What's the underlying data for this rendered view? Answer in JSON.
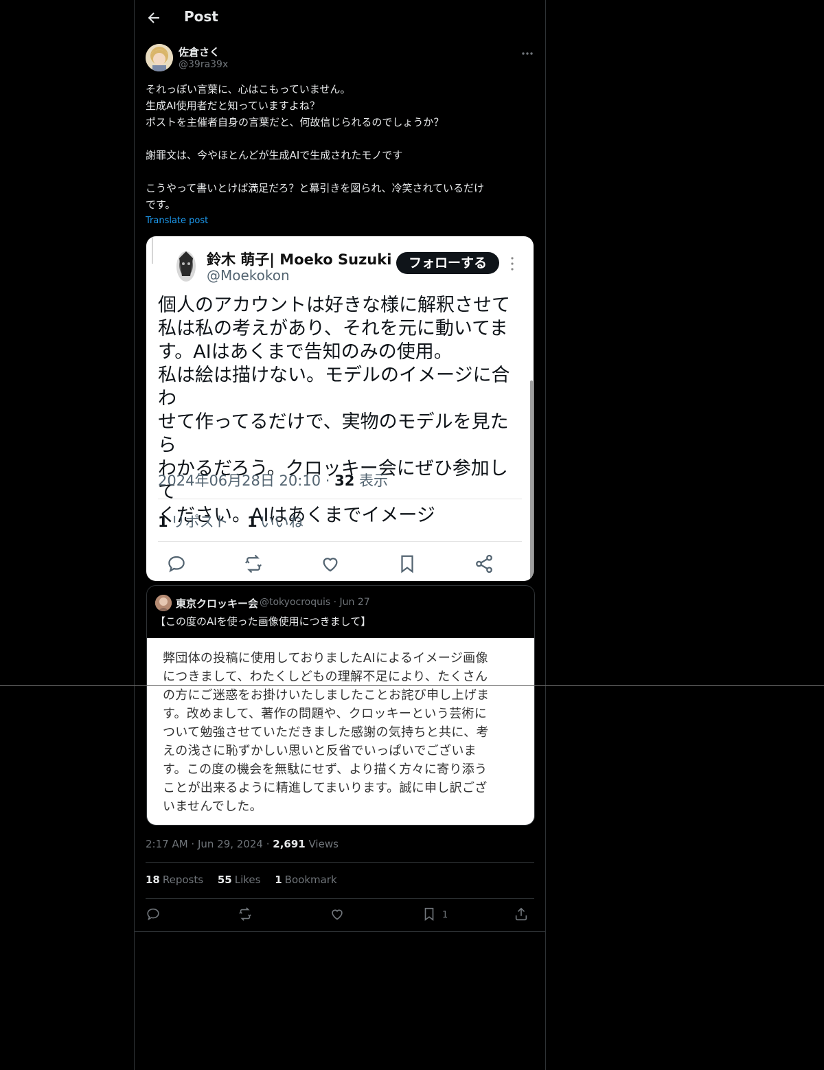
{
  "header": {
    "title": "Post"
  },
  "author": {
    "name": "佐倉さく",
    "handle": "@39ra39x"
  },
  "post": {
    "lines": [
      "それっぽい言葉に、心はこもっていません。",
      "生成AI使用者だと知っていますよね？",
      "ポストを主催者自身の言葉だと、何故信じられるのでしょうか？",
      "",
      "謝罪文は、今やほとんどが生成AIで生成されたモノです",
      "",
      "こうやって書いとけば満足だろ？と幕引きを図られ、冷笑されているだけ",
      "です。"
    ],
    "translate": "Translate post"
  },
  "screenshot": {
    "name": "鈴木 萌子| Moeko Suzuki",
    "handle": "@Moekokon",
    "follow": "フォローする",
    "body": [
      "個人のアカウントは好きな様に解釈させて",
      "私は私の考えがあり、それを元に動いてま",
      "す。AIはあくまで告知のみの使用。",
      "私は絵は描けない。モデルのイメージに合わ",
      "せて作ってるだけで、実物のモデルを見たら",
      "わかるだろう。クロッキー会にぜひ参加して",
      "ください。AIはあくまでイメージ"
    ],
    "timestamp": "2024年06月28日 20:10 · ",
    "views_count": "32",
    "views_label": " 表示",
    "reposts_count": "1",
    "reposts_label": "リポスト",
    "likes_count": "1",
    "likes_label": "いいね"
  },
  "quote": {
    "name": "東京クロッキー会",
    "handle": "@tokyocroquis · Jun 27",
    "text": "【この度のAIを使った画像使用につきまして】",
    "image_lines": [
      "弊団体の投稿に使用しておりましたAIによるイメージ画像",
      "につきまして、わたくしどもの理解不足により、たくさん",
      "の方にご迷惑をお掛けいたしましたことお詫び申し上げま",
      "す。改めまして、著作の問題や、クロッキーという芸術に",
      "ついて勉強させていただきました感謝の気持ちと共に、考",
      "えの浅さに恥ずかしい思いと反省でいっぱいでございま",
      "す。この度の機会を無駄にせず、より描く方々に寄り添う",
      "ことが出来るように精進してまいります。誠に申し訳ござ",
      "いませんでした。"
    ]
  },
  "meta": {
    "time": "2:17 AM · Jun 29, 2024 · ",
    "views_count": "2,691",
    "views_label": " Views"
  },
  "stats": {
    "reposts_count": "18",
    "reposts_label": "Reposts",
    "likes_count": "55",
    "likes_label": "Likes",
    "bookmarks_count": "1",
    "bookmarks_label": "Bookmark"
  },
  "actions": {
    "bookmark_count": "1"
  }
}
